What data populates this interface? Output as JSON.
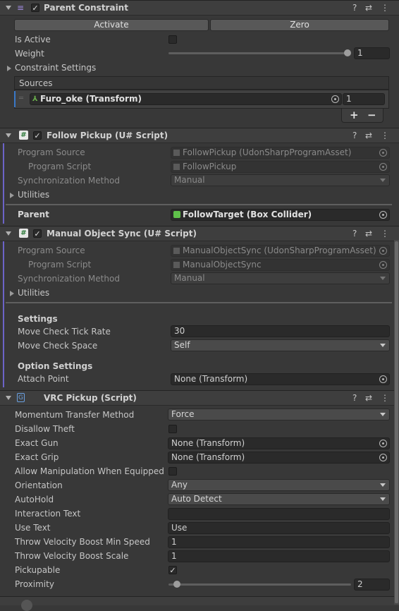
{
  "parent_constraint": {
    "title": "Parent Constraint",
    "activate": "Activate",
    "zero": "Zero",
    "is_active_label": "Is Active",
    "weight_label": "Weight",
    "weight_value": "1",
    "weight_fraction": 1.0,
    "constraint_settings": "Constraint Settings",
    "sources_label": "Sources",
    "source_name": "Furo_oke (Transform)",
    "source_weight": "1",
    "add": "+",
    "remove": "−"
  },
  "follow_pickup": {
    "title": "Follow Pickup (U# Script)",
    "program_source_label": "Program Source",
    "program_source_value": "FollowPickup (UdonSharpProgramAsset)",
    "program_script_label": "Program Script",
    "program_script_value": "FollowPickup",
    "sync_label": "Synchronization Method",
    "sync_value": "Manual",
    "utilities": "Utilities",
    "parent_label": "Parent",
    "parent_value": "FollowTarget (Box Collider)"
  },
  "manual_sync": {
    "title": "Manual Object Sync (U# Script)",
    "program_source_label": "Program Source",
    "program_source_value": "ManualObjectSync (UdonSharpProgramAsset)",
    "program_script_label": "Program Script",
    "program_script_value": "ManualObjectSync",
    "sync_label": "Synchronization Method",
    "sync_value": "Manual",
    "utilities": "Utilities",
    "settings_heading": "Settings",
    "tick_rate_label": "Move Check Tick Rate",
    "tick_rate_value": "30",
    "check_space_label": "Move Check Space",
    "check_space_value": "Self",
    "option_heading": "Option Settings",
    "attach_label": "Attach Point",
    "attach_value": "None (Transform)"
  },
  "vrc_pickup": {
    "title": "VRC Pickup (Script)",
    "rows": [
      {
        "label": "Momentum Transfer Method",
        "value": "Force"
      },
      {
        "label": "Disallow Theft",
        "value": ""
      },
      {
        "label": "Exact Gun",
        "value": "None (Transform)"
      },
      {
        "label": "Exact Grip",
        "value": "None (Transform)"
      },
      {
        "label": "Allow Manipulation When Equipped",
        "value": ""
      },
      {
        "label": "Orientation",
        "value": "Any"
      },
      {
        "label": "AutoHold",
        "value": "Auto Detect"
      },
      {
        "label": "Interaction Text",
        "value": ""
      },
      {
        "label": "Use Text",
        "value": "Use"
      },
      {
        "label": "Throw Velocity Boost Min Speed",
        "value": "1"
      },
      {
        "label": "Throw Velocity Boost Scale",
        "value": "1"
      },
      {
        "label": "Pickupable",
        "value": "✓"
      },
      {
        "label": "Proximity",
        "value": "2"
      }
    ],
    "proximity_fraction": 0.03
  },
  "header_icons": {
    "help": "?",
    "settings": "⇄",
    "menu": "⋮"
  }
}
